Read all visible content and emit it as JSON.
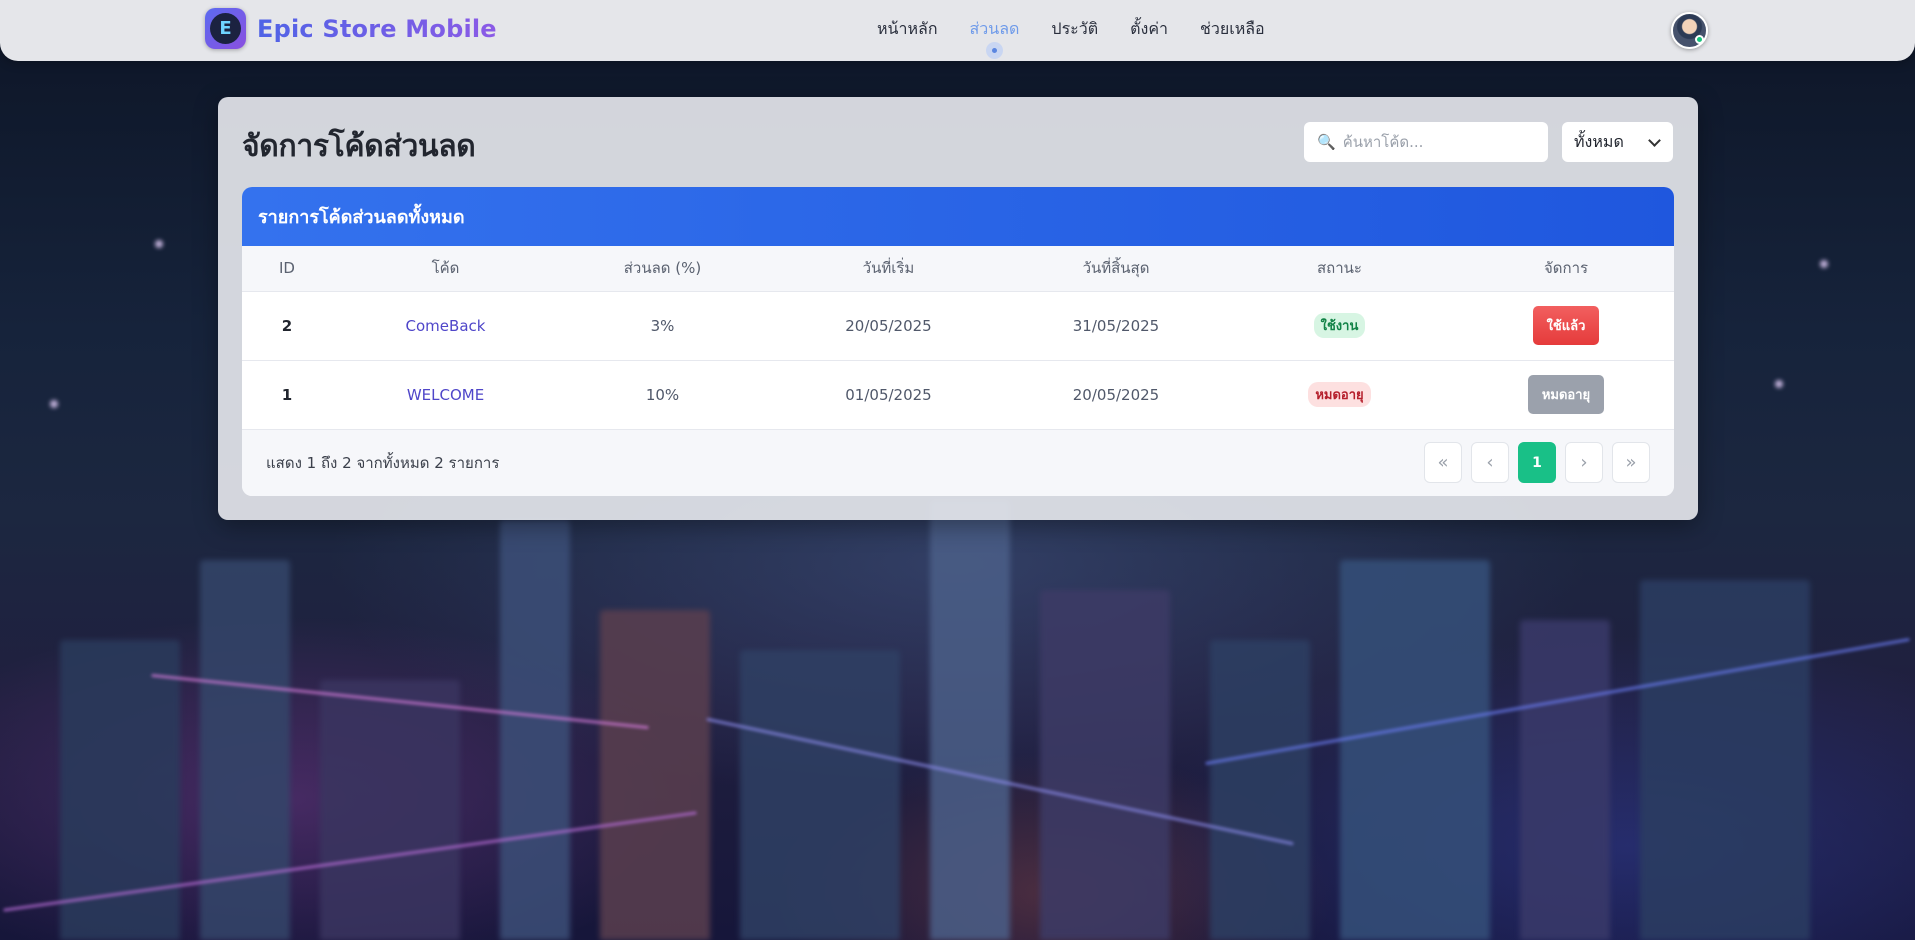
{
  "brand": {
    "name": "Epic Store Mobile",
    "logo_letter": "E"
  },
  "nav": [
    {
      "label": "หน้าหลัก",
      "active": false
    },
    {
      "label": "ส่วนลด",
      "active": true
    },
    {
      "label": "ประวัติ",
      "active": false
    },
    {
      "label": "ตั้งค่า",
      "active": false
    },
    {
      "label": "ช่วยเหลือ",
      "active": false
    }
  ],
  "page": {
    "title": "จัดการโค้ดส่วนลด"
  },
  "search": {
    "placeholder": "ค้นหาโค้ด...",
    "value": ""
  },
  "filter": {
    "selected": "ทั้งหมด"
  },
  "table": {
    "header_title": "รายการโค้ดส่วนลดทั้งหมด",
    "columns": [
      "ID",
      "โค้ด",
      "ส่วนลด (%)",
      "วันที่เริ่ม",
      "วันที่สิ้นสุด",
      "สถานะ",
      "จัดการ"
    ],
    "rows": [
      {
        "id": "2",
        "code": "ComeBack",
        "discount": "3%",
        "start": "20/05/2025",
        "end": "31/05/2025",
        "status": "ใช้งาน",
        "status_color": "#128347",
        "action": "ใช้แล้ว",
        "action_color": "#e53b3b"
      },
      {
        "id": "1",
        "code": "WELCOME",
        "discount": "10%",
        "start": "01/05/2025",
        "end": "20/05/2025",
        "status": "หมดอายุ",
        "status_color": "#b51f2c",
        "action": "หมดอายุ",
        "action_color": "#9ba1ac"
      }
    ]
  },
  "footer": {
    "info": "แสดง 1 ถึง 2 จากทั้งหมด 2 รายการ"
  },
  "pagination": {
    "first": "«",
    "prev": "‹",
    "current": "1",
    "next": "›",
    "last": "»"
  },
  "colors": {
    "accent": "#1f57de",
    "pager_active": "#19c087",
    "nav_active": "#6f9bea"
  }
}
